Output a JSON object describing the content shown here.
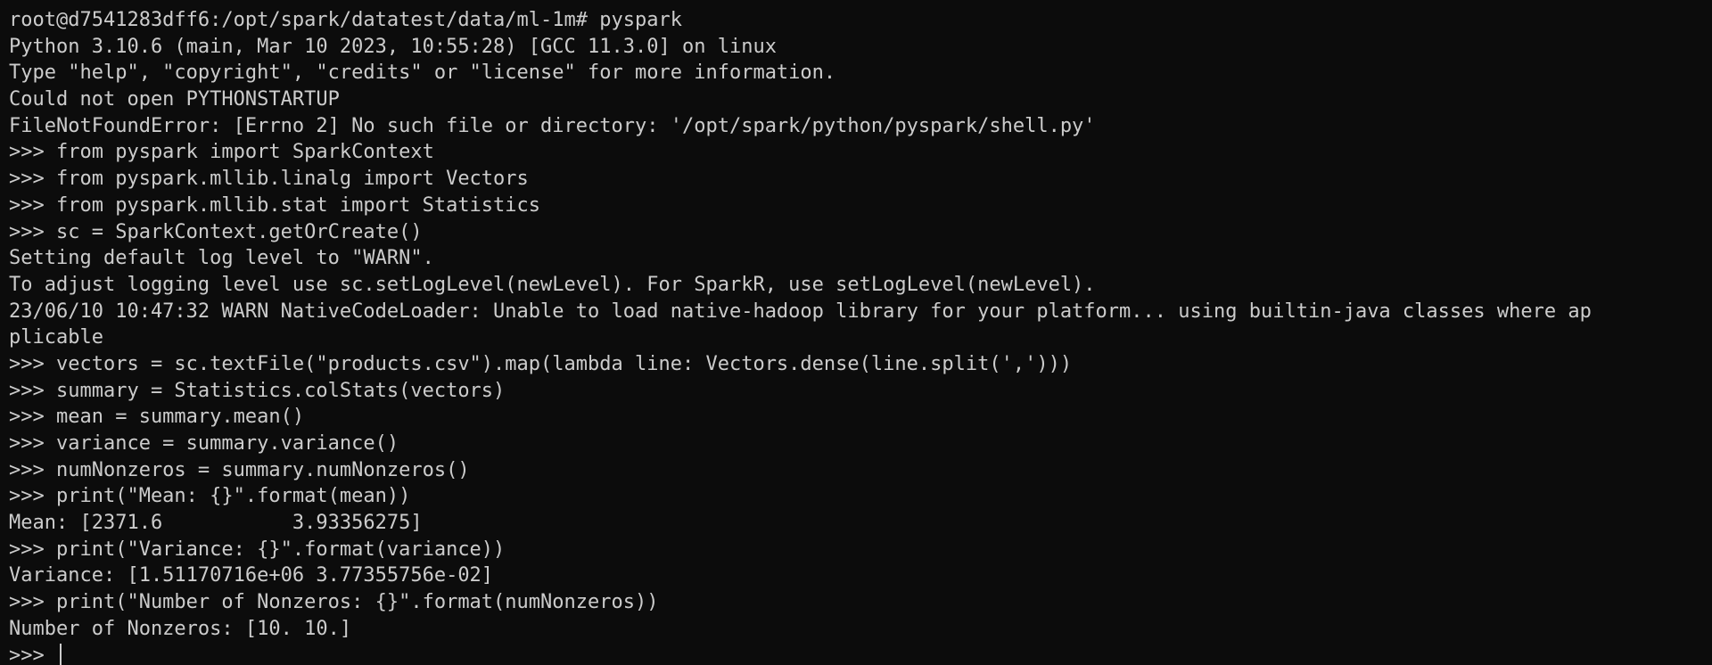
{
  "terminal": {
    "lines": [
      "root@d7541283dff6:/opt/spark/datatest/data/ml-1m# pyspark",
      "Python 3.10.6 (main, Mar 10 2023, 10:55:28) [GCC 11.3.0] on linux",
      "Type \"help\", \"copyright\", \"credits\" or \"license\" for more information.",
      "Could not open PYTHONSTARTUP",
      "FileNotFoundError: [Errno 2] No such file or directory: '/opt/spark/python/pyspark/shell.py'",
      ">>> from pyspark import SparkContext",
      ">>> from pyspark.mllib.linalg import Vectors",
      ">>> from pyspark.mllib.stat import Statistics",
      ">>> sc = SparkContext.getOrCreate()",
      "Setting default log level to \"WARN\".",
      "To adjust logging level use sc.setLogLevel(newLevel). For SparkR, use setLogLevel(newLevel).",
      "23/06/10 10:47:32 WARN NativeCodeLoader: Unable to load native-hadoop library for your platform... using builtin-java classes where ap",
      "plicable",
      ">>> vectors = sc.textFile(\"products.csv\").map(lambda line: Vectors.dense(line.split(',')))",
      ">>> summary = Statistics.colStats(vectors)",
      ">>> mean = summary.mean()",
      ">>> variance = summary.variance()",
      ">>> numNonzeros = summary.numNonzeros()",
      ">>> print(\"Mean: {}\".format(mean))",
      "Mean: [2371.6           3.93356275]",
      ">>> print(\"Variance: {}\".format(variance))",
      "Variance: [1.51170716e+06 3.77355756e-02]",
      ">>> print(\"Number of Nonzeros: {}\".format(numNonzeros))",
      "Number of Nonzeros: [10. 10.]"
    ],
    "current_prompt": ">>> "
  }
}
